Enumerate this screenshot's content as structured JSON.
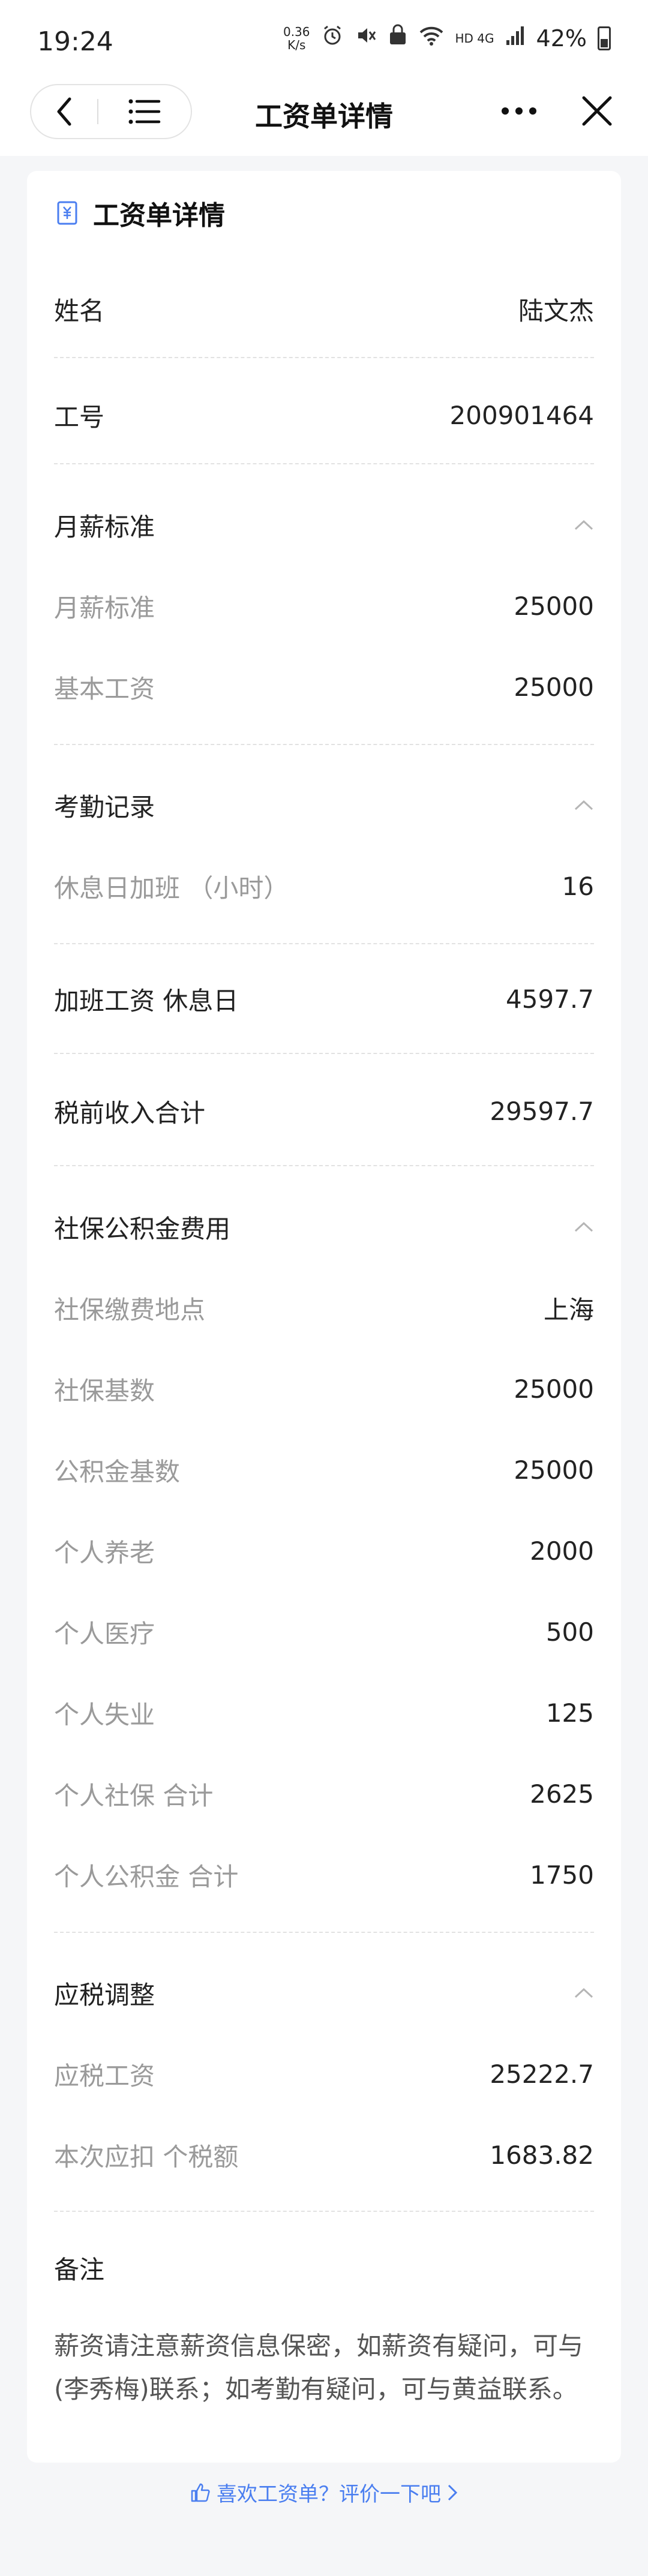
{
  "status": {
    "time": "19:24",
    "netspeed_value": "0.36",
    "netspeed_unit": "K/s",
    "network_label": "HD 4G",
    "battery": "42%"
  },
  "nav": {
    "title": "工资单详情"
  },
  "card": {
    "title": "工资单详情",
    "icon": "salary-doc-icon"
  },
  "rows": {
    "name": {
      "label": "姓名",
      "value": "陆文杰"
    },
    "id": {
      "label": "工号",
      "value": "200901464"
    },
    "salary_section": {
      "label": "月薪标准"
    },
    "monthly_std": {
      "label": "月薪标准",
      "value": "25000"
    },
    "base_pay": {
      "label": "基本工资",
      "value": "25000"
    },
    "attendance_section": {
      "label": "考勤记录"
    },
    "rest_ot": {
      "label": "休息日加班 （小时）",
      "value": "16"
    },
    "ot_pay": {
      "label": "加班工资 休息日",
      "value": "4597.7"
    },
    "pretax_total": {
      "label": "税前收入合计",
      "value": "29597.7"
    },
    "insurance_section": {
      "label": "社保公积金费用"
    },
    "ins_location": {
      "label": "社保缴费地点",
      "value": "上海"
    },
    "ins_base": {
      "label": "社保基数",
      "value": "25000"
    },
    "fund_base": {
      "label": "公积金基数",
      "value": "25000"
    },
    "pension": {
      "label": "个人养老",
      "value": "2000"
    },
    "medical": {
      "label": "个人医疗",
      "value": "500"
    },
    "unemployment": {
      "label": "个人失业",
      "value": "125"
    },
    "ins_total": {
      "label": "个人社保 合计",
      "value": "2625"
    },
    "fund_total": {
      "label": "个人公积金 合计",
      "value": "1750"
    },
    "tax_section": {
      "label": "应税调整"
    },
    "taxable_pay": {
      "label": "应税工资",
      "value": "25222.7"
    },
    "tax_amount": {
      "label": "本次应扣 个税额",
      "value": "1683.82"
    },
    "remark_section": {
      "label": "备注"
    }
  },
  "remark_text": "薪资请注意薪资信息保密，如薪资有疑问，可与(李秀梅)联系；如考勤有疑问，可与黄益联系。",
  "footer": {
    "link_text": "喜欢工资单？评价一下吧",
    "icon": "thumbs-up-icon"
  },
  "colors": {
    "accent": "#4a7ef0",
    "muted_label": "#9a9a9a"
  }
}
